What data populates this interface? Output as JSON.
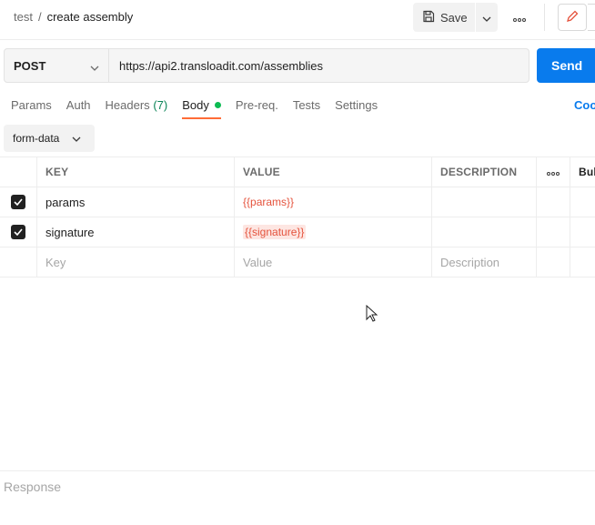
{
  "breadcrumb": {
    "parent": "test",
    "separator": "/",
    "current": "create assembly"
  },
  "toolbar": {
    "save_label": "Save"
  },
  "request": {
    "method": "POST",
    "url": "https://api2.transloadit.com/assemblies",
    "send_label": "Send"
  },
  "tabs": {
    "params": "Params",
    "auth": "Auth",
    "headers": "Headers",
    "headers_count": "(7)",
    "body": "Body",
    "prereq": "Pre-req.",
    "tests": "Tests",
    "settings": "Settings",
    "cookies": "Coo"
  },
  "body_type": "form-data",
  "table": {
    "headers": {
      "key": "KEY",
      "value": "VALUE",
      "description": "DESCRIPTION",
      "bulk": "Bul"
    },
    "rows": [
      {
        "key": "params",
        "value": "{{params}}",
        "description": ""
      },
      {
        "key": "signature",
        "value": "{{signature}}",
        "description": ""
      }
    ],
    "placeholders": {
      "key": "Key",
      "value": "Value",
      "description": "Description"
    }
  },
  "response": {
    "label": "Response"
  },
  "colors": {
    "accent": "#ff6c37",
    "send": "#097bed",
    "status_dot": "#0cbb52",
    "variable": "#e5533d"
  }
}
